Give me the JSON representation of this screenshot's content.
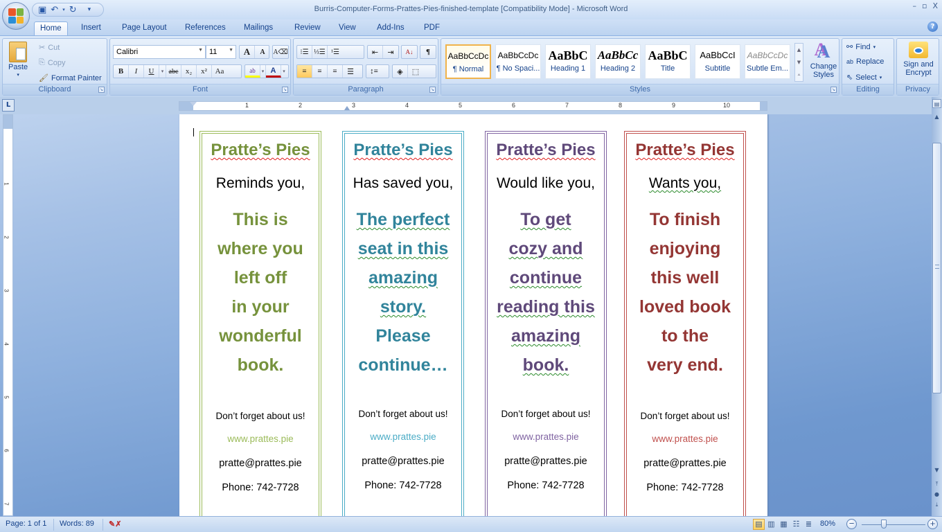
{
  "window": {
    "title": "Burris-Computer-Forms-Prattes-Pies-finished-template [Compatibility Mode] - Microsoft Word",
    "controls": {
      "minimize": "–",
      "restore": "▫",
      "close": "X"
    }
  },
  "quick_access": {
    "save": "save-icon",
    "undo": "undo-icon",
    "redo": "redo-icon",
    "customize": "▾"
  },
  "tabs": [
    {
      "label": "Home",
      "active": true
    },
    {
      "label": "Insert"
    },
    {
      "label": "Page Layout"
    },
    {
      "label": "References"
    },
    {
      "label": "Mailings"
    },
    {
      "label": "Review"
    },
    {
      "label": "View"
    },
    {
      "label": "Add-Ins"
    },
    {
      "label": "PDF"
    }
  ],
  "ribbon": {
    "clipboard": {
      "label": "Clipboard",
      "paste": "Paste",
      "cut": "Cut",
      "copy": "Copy",
      "format_painter": "Format Painter"
    },
    "font": {
      "label": "Font",
      "font_name": "Calibri",
      "font_size": "11",
      "grow": "A",
      "shrink": "A",
      "bold": "B",
      "italic": "I",
      "underline": "U",
      "strike": "abc",
      "subscript": "x₂",
      "superscript": "x²",
      "change_case": "Aa",
      "highlight_color": "#ffff00",
      "font_color": "#c00000"
    },
    "paragraph": {
      "label": "Paragraph"
    },
    "styles": {
      "label": "Styles",
      "items": [
        {
          "sample": "AaBbCcDc",
          "name": "¶ Normal",
          "selected": true
        },
        {
          "sample": "AaBbCcDc",
          "name": "¶ No Spaci..."
        },
        {
          "sample": "AaBbC",
          "name": "Heading 1"
        },
        {
          "sample": "AaBbCc",
          "name": "Heading 2"
        },
        {
          "sample": "AaBbC",
          "name": "Title"
        },
        {
          "sample": "AaBbCcI",
          "name": "Subtitle"
        },
        {
          "sample": "AaBbCcDc",
          "name": "Subtle Em..."
        }
      ],
      "change_styles": "Change Styles"
    },
    "editing": {
      "label": "Editing",
      "find": "Find",
      "replace": "Replace",
      "select": "Select"
    },
    "privacy": {
      "label": "Privacy",
      "sign_encrypt": "Sign and Encrypt"
    }
  },
  "ruler": {
    "numbers": [
      "1",
      "2",
      "3",
      "4",
      "5",
      "6",
      "7",
      "8",
      "9",
      "10"
    ],
    "vnumbers": [
      "1",
      "2",
      "3",
      "4",
      "5",
      "6",
      "7"
    ]
  },
  "bookmarks": [
    {
      "color": "#9bbb59",
      "text_color": "#76923c",
      "title": "Pratte’s Pies",
      "intro": "Reminds you,",
      "message": [
        "This is",
        "where you",
        "left off",
        "in your",
        "wonderful",
        "book."
      ],
      "footer": "Don’t forget about us!",
      "website": "www.prattes.pie",
      "email": "pratte@prattes.pie",
      "phone": "Phone: 742-7728"
    },
    {
      "color": "#4bacc6",
      "text_color": "#31849b",
      "title": "Pratte’s Pies",
      "intro": "Has saved you,",
      "message": [
        "The perfect",
        "seat in this",
        "amazing",
        "story.",
        "Please",
        "continue…"
      ],
      "footer": "Don’t forget about us!",
      "website": "www.prattes.pie",
      "email": "pratte@prattes.pie",
      "phone": "Phone: 742-7728"
    },
    {
      "color": "#8064a2",
      "text_color": "#5f497a",
      "title": "Pratte’s Pies",
      "intro": "Would like you,",
      "message": [
        "To get",
        "cozy and",
        "continue",
        "reading this",
        "amazing",
        "book."
      ],
      "footer": "Don’t forget about us!",
      "website": "www.prattes.pie",
      "email": "pratte@prattes.pie",
      "phone": "Phone: 742-7728"
    },
    {
      "color": "#c0504d",
      "text_color": "#943634",
      "title": "Pratte’s Pies",
      "intro": "Wants  you,",
      "message": [
        "To finish",
        "enjoying",
        "this well",
        "loved book",
        "to the",
        "very end."
      ],
      "footer": "Don’t forget about us!",
      "website": "www.prattes.pie",
      "email": "pratte@prattes.pie",
      "phone": "Phone: 742-7728"
    }
  ],
  "status": {
    "page": "Page: 1 of 1",
    "words": "Words: 89",
    "zoom": "80%",
    "zoom_value": 80
  }
}
